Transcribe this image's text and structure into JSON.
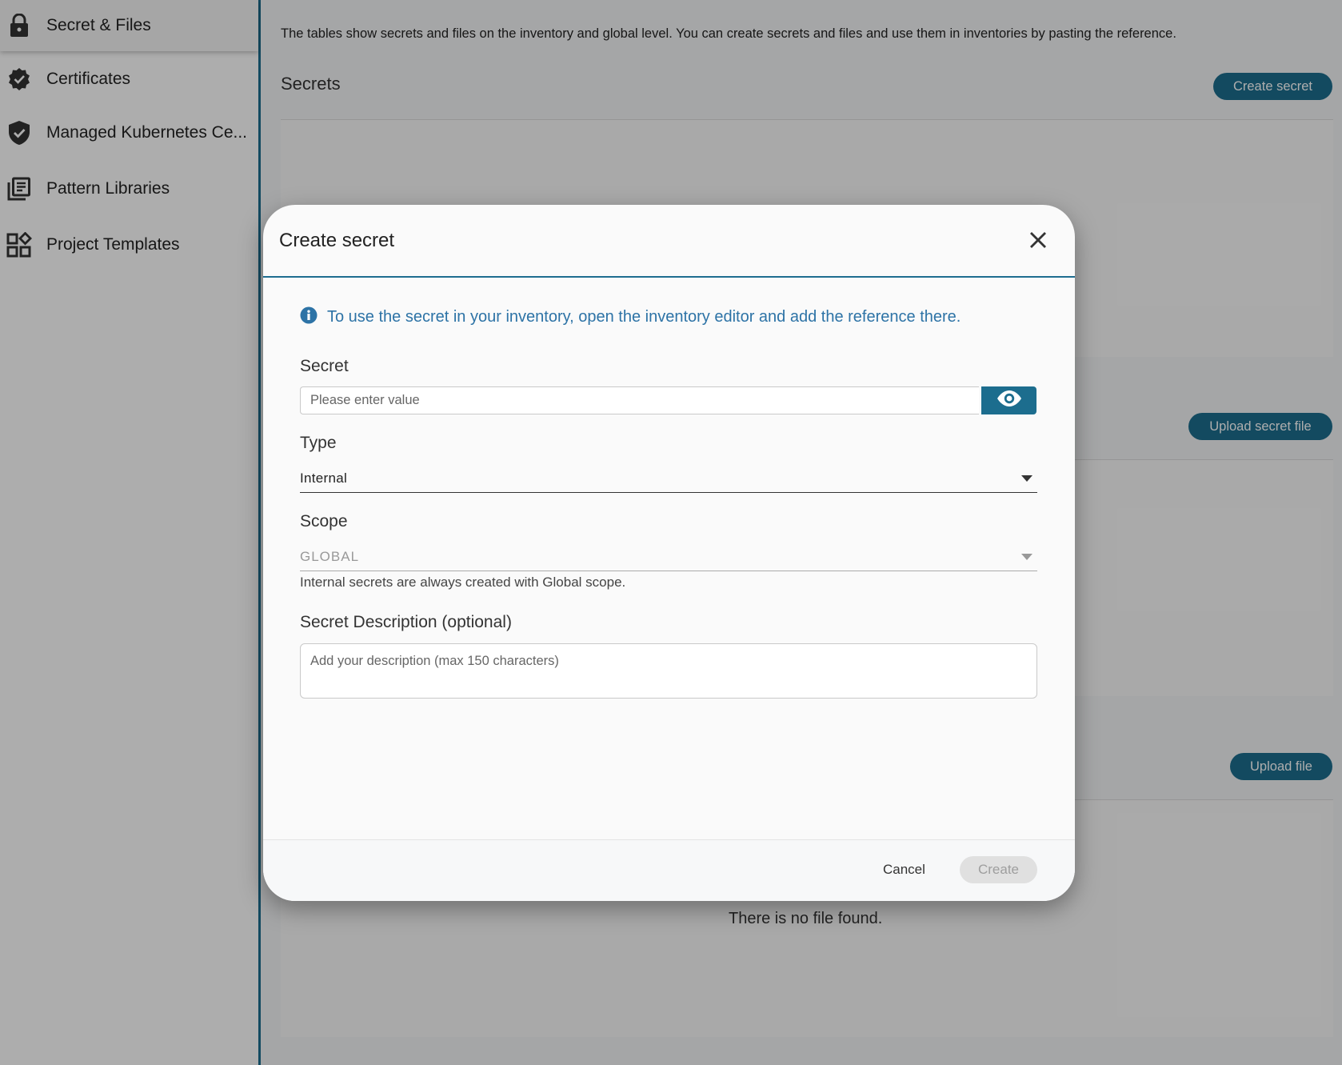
{
  "sidebar": {
    "items": [
      {
        "label": "Secret & Files",
        "icon": "lock-icon",
        "active": true
      },
      {
        "label": "Certificates",
        "icon": "certificate-badge-icon"
      },
      {
        "label": "Managed Kubernetes Ce...",
        "icon": "shield-check-icon"
      },
      {
        "label": "Pattern Libraries",
        "icon": "library-icon"
      },
      {
        "label": "Project Templates",
        "icon": "templates-icon"
      }
    ]
  },
  "main": {
    "intro": "The tables show secrets and files on the inventory and global level. You can create secrets and files and use them in inventories by pasting the reference.",
    "secrets_title": "Secrets",
    "create_secret_button": "Create secret",
    "upload_secret_file_button": "Upload secret file",
    "upload_file_button": "Upload file",
    "no_file_text": "There is no file found."
  },
  "dialog": {
    "title": "Create secret",
    "close_icon": "close-icon",
    "info_text": "To use the secret in your inventory, open the inventory editor and add the reference there.",
    "secret_label": "Secret",
    "secret_placeholder": "Please enter value",
    "secret_value": "",
    "type_label": "Type",
    "type_value": "Internal",
    "scope_label": "Scope",
    "scope_value": "GLOBAL",
    "scope_hint": "Internal secrets are always created with Global scope.",
    "description_label": "Secret Description (optional)",
    "description_placeholder": "Add your description (max 150 characters)",
    "description_value": "",
    "cancel_label": "Cancel",
    "create_label": "Create"
  },
  "colors": {
    "accent": "#1c6d8e",
    "info": "#2d73a6",
    "disabled_button": "#e0e0e0"
  }
}
